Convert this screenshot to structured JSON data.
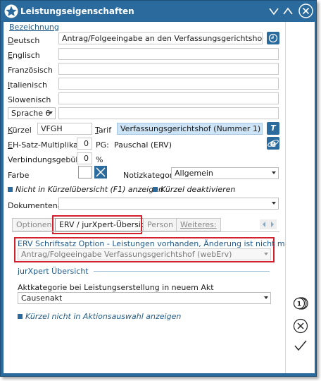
{
  "window": {
    "title": "Leistungseigenschaften"
  },
  "section": {
    "bezeichnung": "Bezeichnung"
  },
  "languages": [
    {
      "label": "Deutsch",
      "value": "Antrag/Folgeeingabe an den Verfassungsgerichtshof"
    },
    {
      "label": "Englisch",
      "value": ""
    },
    {
      "label": "Französisch",
      "value": ""
    },
    {
      "label": "Italienisch",
      "value": ""
    },
    {
      "label": "Slowenisch",
      "value": ""
    }
  ],
  "sprache": {
    "selected": "Sprache 6",
    "value": ""
  },
  "kuerzel": {
    "label": "Kürzel",
    "value": "VFGH"
  },
  "tarif": {
    "label": "Tarif",
    "value": "Verfassungsgerichtshof (Nummer 1)",
    "button": "T"
  },
  "eh_satz": {
    "label": "EH-Satz-Multiplikator",
    "value": "0",
    "pg_label": "PG:",
    "pg_value": "Pauschal (ERV)"
  },
  "verbindung": {
    "label": "Verbindungsgebühr",
    "value": "0",
    "unit": "%"
  },
  "farbe": {
    "label": "Farbe"
  },
  "notiz": {
    "label": "Notizkategorie",
    "selected": "Allgemein"
  },
  "checks": {
    "nicht_in_kuerzel": "Nicht in Kürzelübersicht (F1) anzeigen",
    "kuerzel_deaktivieren": "Kürzel deaktivieren"
  },
  "dokumentenart": {
    "label": "Dokumentenart",
    "selected": ""
  },
  "tabs": [
    "Optionen",
    "ERV / jurXpert-Übersicht",
    "Person",
    "Weiteres:"
  ],
  "erv": {
    "option_label": "ERV Schriftsatz Option - Leistungen vorhanden, Änderung ist nicht möglich",
    "option_value": "Antrag/Folgeeingabe Verfassungsgerichtshof (webErv)"
  },
  "jurxpert": {
    "heading": "jurXpert Übersicht",
    "akt_label": "Aktkategorie bei Leistungserstellung in neuem Akt",
    "akt_value": "Causenakt",
    "check": "Kürzel nicht in Aktionsauswahl anzeigen"
  },
  "colors": {
    "accent": "#2b6a9c",
    "highlight_red": "#d2202e",
    "field_blue": "#cce4f6"
  }
}
